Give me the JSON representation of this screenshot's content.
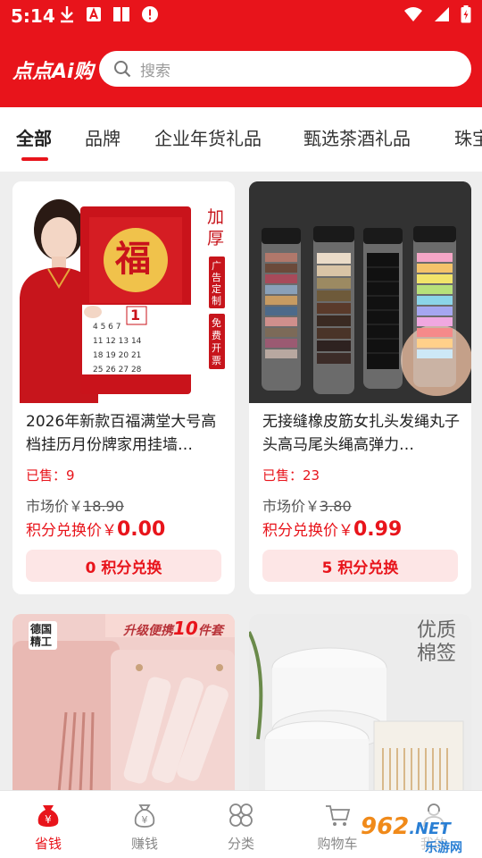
{
  "status_bar": {
    "time": "5:14"
  },
  "header": {
    "brand": "点点Ai购",
    "search_placeholder": "搜索"
  },
  "tabs": [
    {
      "label": "全部"
    },
    {
      "label": "品牌"
    },
    {
      "label": "企业年货礼品"
    },
    {
      "label": "甄选茶酒礼品"
    },
    {
      "label": "珠宝"
    }
  ],
  "products": [
    {
      "title": "2026年新款百福满堂大号高档挂历月份牌家用挂墙…",
      "sold_label": "已售：",
      "sold": "9",
      "market_label": "市场价￥",
      "market_price": "18.90",
      "points_label": "积分兑换价￥",
      "points_price": "0.00",
      "button": "0 积分兑换",
      "image_text": {
        "side1": "加厚",
        "side2": "广告定制",
        "side3": "免费开票",
        "fu": "福",
        "day": "1"
      }
    },
    {
      "title": "无接缝橡皮筋女扎头发绳丸子头高马尾头绳高弹力…",
      "sold_label": "已售：",
      "sold": "23",
      "market_label": "市场价￥",
      "market_price": "3.80",
      "points_label": "积分兑换价￥",
      "points_price": "0.99",
      "button": "5 积分兑换"
    },
    {
      "image_text": {
        "badge": "德国精工",
        "banner_prefix": "升级便携",
        "banner_num": "10",
        "banner_suffix": "件套"
      }
    },
    {
      "image_text": {
        "line1": "优质",
        "line2": "棉签"
      }
    }
  ],
  "bottom_nav": [
    {
      "label": "省钱",
      "icon": "money-bag-icon",
      "active": true
    },
    {
      "label": "赚钱",
      "icon": "coin-bag-icon",
      "active": false
    },
    {
      "label": "分类",
      "icon": "category-grid-icon",
      "active": false
    },
    {
      "label": "购物车",
      "icon": "cart-icon",
      "active": false
    },
    {
      "label": "我的",
      "icon": "user-icon",
      "active": false
    }
  ],
  "watermark": {
    "text": "962",
    "suffix": ".NET",
    "sub": "乐游网"
  },
  "colors": {
    "accent": "#e8141b",
    "button_bg": "#fde6e6"
  }
}
